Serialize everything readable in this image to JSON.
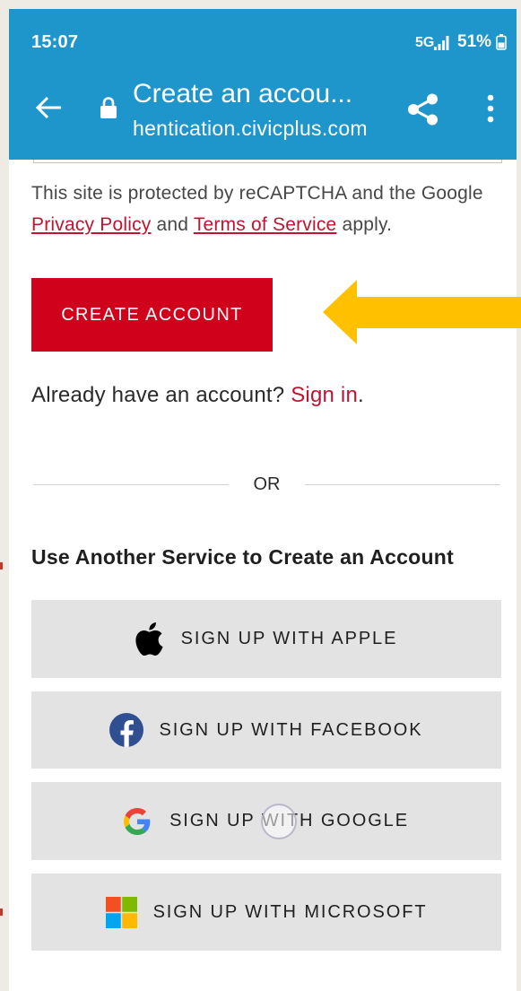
{
  "status_bar": {
    "time": "15:07",
    "network": "5G",
    "battery": "51%",
    "signal_icon": "signal-icon",
    "battery_icon": "battery-icon"
  },
  "toolbar": {
    "back_icon": "back-arrow-icon",
    "lock_icon": "lock-icon",
    "title": "Create an accou...",
    "url": "hentication.civicplus.com",
    "share_icon": "share-icon",
    "menu_icon": "more-vert-icon"
  },
  "notice": {
    "intro": "This site is protected by reCAPTCHA and the Google",
    "privacy_link": "Privacy Policy",
    "conjunction": "and",
    "terms_link": "Terms of Service",
    "suffix": "apply."
  },
  "create_account": {
    "label": "CREATE ACCOUNT"
  },
  "annotation": {
    "icon": "left-arrow-icon"
  },
  "signin": {
    "prompt": "Already have an account?",
    "link": "Sign in",
    "period": "."
  },
  "divider": {
    "label": "OR"
  },
  "services": {
    "heading": "Use Another Service to Create an Account",
    "buttons": [
      {
        "label": "SIGN UP WITH APPLE",
        "icon": "apple-icon"
      },
      {
        "label": "SIGN UP WITH FACEBOOK",
        "icon": "facebook-icon"
      },
      {
        "label": "SIGN UP WITH GOOGLE",
        "icon": "google-icon"
      },
      {
        "label": "SIGN UP WITH MICROSOFT",
        "icon": "microsoft-icon"
      }
    ]
  },
  "colors": {
    "app_bar": "#1E96CC",
    "primary_button": "#D0021B",
    "link": "#C41230",
    "service_button": "#E3E3E3",
    "annotation_arrow": "#FFC000",
    "frame": "#EEEAE4",
    "facebook": "#2F4F91"
  }
}
